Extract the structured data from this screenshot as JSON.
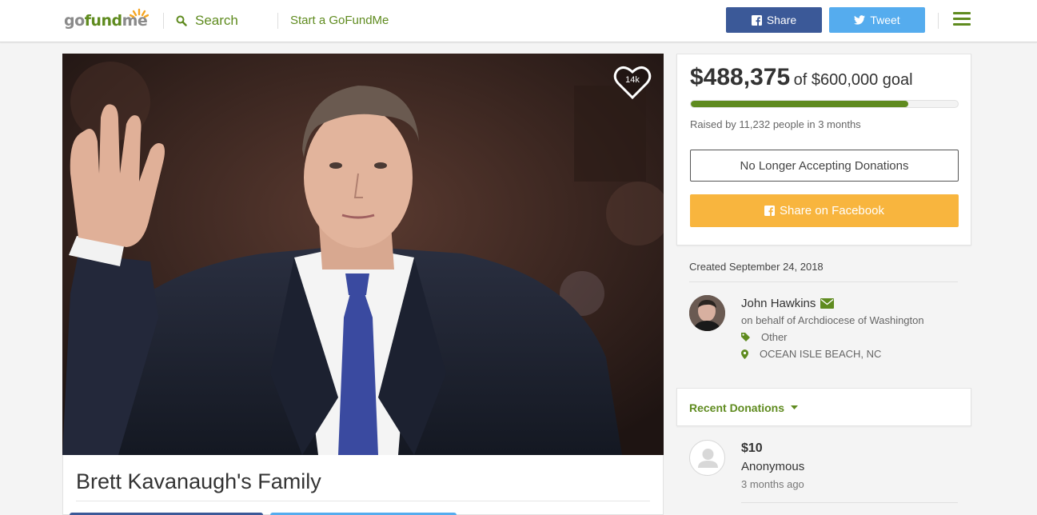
{
  "header": {
    "logo": {
      "go": "go",
      "fund": "fund",
      "me": "me"
    },
    "search_label": "Search",
    "start_link": "Start a GoFundMe",
    "share_label": "Share",
    "tweet_label": "Tweet",
    "icons": {
      "search": "search-icon",
      "facebook": "facebook-icon",
      "twitter": "twitter-icon",
      "menu": "hamburger-menu-icon"
    }
  },
  "campaign": {
    "title": "Brett Kavanaugh's Family",
    "heart_count": "14k"
  },
  "donation": {
    "raised": "$488,375",
    "goal_text": "of $600,000 goal",
    "progress_fraction": 0.814,
    "raised_by": "Raised by 11,232 people in 3 months",
    "closed_label": "No Longer Accepting Donations",
    "share_fb_label": "Share on Facebook"
  },
  "organizer": {
    "created": "Created September 24, 2018",
    "name": "John Hawkins",
    "behalf": "on behalf of Archdiocese of Washington",
    "category": "Other",
    "location": "OCEAN ISLE BEACH, NC"
  },
  "recent": {
    "label": "Recent Donations",
    "items": [
      {
        "amount": "$10",
        "name": "Anonymous",
        "time": "3 months ago"
      }
    ]
  },
  "colors": {
    "brand_green": "#5f8b1f",
    "facebook_blue": "#3b5998",
    "twitter_blue": "#55acee",
    "share_orange": "#f8b53e"
  }
}
